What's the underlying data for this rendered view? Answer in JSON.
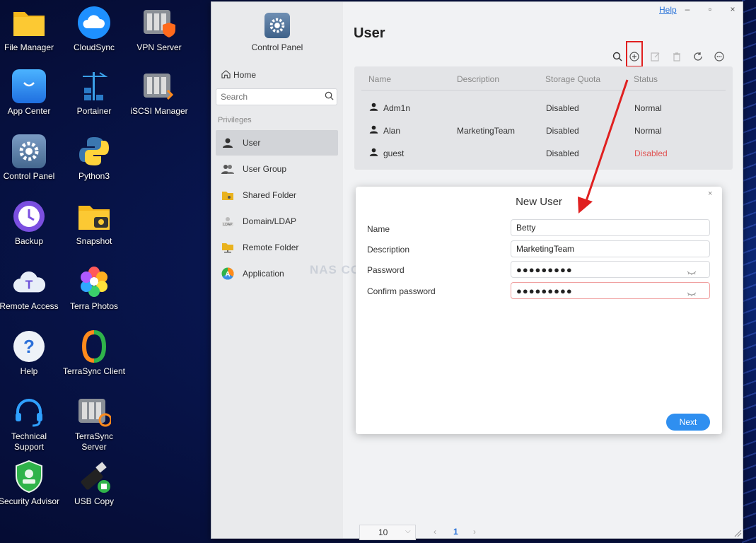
{
  "desktop": {
    "icons": [
      {
        "label": "File Manager"
      },
      {
        "label": "CloudSync"
      },
      {
        "label": "VPN Server"
      },
      {
        "label": "App Center"
      },
      {
        "label": "Portainer"
      },
      {
        "label": "iSCSI Manager"
      },
      {
        "label": "Control Panel"
      },
      {
        "label": "Python3"
      },
      {
        "label": "Backup"
      },
      {
        "label": "Snapshot"
      },
      {
        "label": "Remote Access"
      },
      {
        "label": "Terra Photos"
      },
      {
        "label": "Help"
      },
      {
        "label": "TerraSync Client"
      },
      {
        "label": "Technical Support"
      },
      {
        "label": "TerraSync Server"
      },
      {
        "label": "Security Advisor"
      },
      {
        "label": "USB Copy"
      }
    ]
  },
  "window": {
    "help_label": "Help",
    "minimize": "–",
    "maximize": "▫",
    "close": "×"
  },
  "sidebar": {
    "app_title": "Control Panel",
    "home_label": "Home",
    "search_placeholder": "Search",
    "section_label": "Privileges",
    "items": [
      {
        "label": "User",
        "icon": "user-icon"
      },
      {
        "label": "User Group",
        "icon": "user-group-icon"
      },
      {
        "label": "Shared Folder",
        "icon": "shared-folder-icon"
      },
      {
        "label": "Domain/LDAP",
        "icon": "ldap-icon"
      },
      {
        "label": "Remote Folder",
        "icon": "remote-folder-icon"
      },
      {
        "label": "Application",
        "icon": "application-icon"
      }
    ]
  },
  "main": {
    "title": "User",
    "table": {
      "columns": [
        "Name",
        "Description",
        "Storage Quota",
        "Status"
      ],
      "rows": [
        {
          "name": "Adm1n",
          "description": "",
          "quota": "Disabled",
          "status": "Normal"
        },
        {
          "name": "Alan",
          "description": "MarketingTeam",
          "quota": "Disabled",
          "status": "Normal"
        },
        {
          "name": "guest",
          "description": "",
          "quota": "Disabled",
          "status": "Disabled"
        }
      ]
    },
    "pagination": {
      "page_size": "10",
      "prev": "‹",
      "current_page": "1",
      "next": "›"
    }
  },
  "dialog": {
    "title": "New User",
    "close": "×",
    "fields": {
      "name_label": "Name",
      "name_value": "Betty",
      "description_label": "Description",
      "description_value": "MarketingTeam",
      "password_label": "Password",
      "password_value": "●●●●●●●●●",
      "confirm_label": "Confirm password",
      "confirm_value": "●●●●●●●●●"
    },
    "next_label": "Next"
  },
  "watermark": "NAS COMPARES",
  "colors": {
    "accent": "#2f8ff0",
    "error": "#e05353",
    "annotation": "#e02020"
  }
}
